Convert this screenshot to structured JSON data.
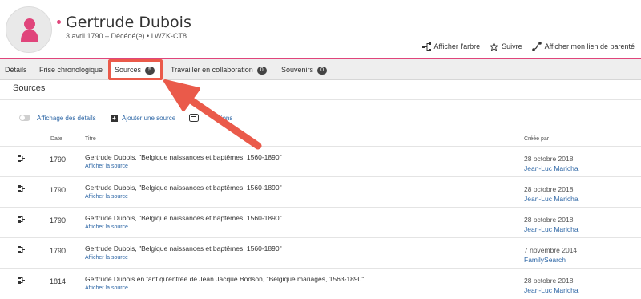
{
  "person": {
    "name": "Gertrude Dubois",
    "meta": "3 avril 1790 – Décédé(e) • LWZK-CT8"
  },
  "actions": {
    "tree": "Afficher l'arbre",
    "follow": "Suivre",
    "relationship": "Afficher mon lien de parenté"
  },
  "tabs": [
    {
      "label": "Détails"
    },
    {
      "label": "Frise chronologique"
    },
    {
      "label": "Sources",
      "count": "5"
    },
    {
      "label": "Travailler en collaboration",
      "count": "0"
    },
    {
      "label": "Souvenirs",
      "count": "0"
    }
  ],
  "section": {
    "title": "Sources"
  },
  "toolbar": {
    "details_toggle": "Affichage des détails",
    "add_source": "Ajouter une source",
    "options_partial": "ptions"
  },
  "table": {
    "headers": {
      "date": "Date",
      "title": "Titre",
      "created": "Créée par"
    },
    "rows": [
      {
        "date": "1790",
        "title": "Gertrude Dubois, \"Belgique naissances et baptêmes, 1560-1890\"",
        "link": "Afficher la source",
        "created": "28 octobre 2018",
        "by": "Jean-Luc Marichal"
      },
      {
        "date": "1790",
        "title": "Gertrude Dubois, \"Belgique naissances et baptêmes, 1560-1890\"",
        "link": "Afficher la source",
        "created": "28 octobre 2018",
        "by": "Jean-Luc Marichal"
      },
      {
        "date": "1790",
        "title": "Gertrude Dubois, \"Belgique naissances et baptêmes, 1560-1890\"",
        "link": "Afficher la source",
        "created": "28 octobre 2018",
        "by": "Jean-Luc Marichal"
      },
      {
        "date": "1790",
        "title": "Gertrude Dubois, \"Belgique naissances et baptêmes, 1560-1890\"",
        "link": "Afficher la source",
        "created": "7 novembre 2014",
        "by": "FamilySearch"
      },
      {
        "date": "1814",
        "title": "Gertrude Dubois en tant qu'entrée de Jean Jacque Bodson, \"Belgique mariages, 1563-1890\"",
        "link": "Afficher la source",
        "created": "28 octobre 2018",
        "by": "Jean-Luc Marichal"
      }
    ]
  },
  "colors": {
    "accent_pink": "#e0457b",
    "annotation_red": "#ea5a4a",
    "link_blue": "#2e67a6"
  }
}
